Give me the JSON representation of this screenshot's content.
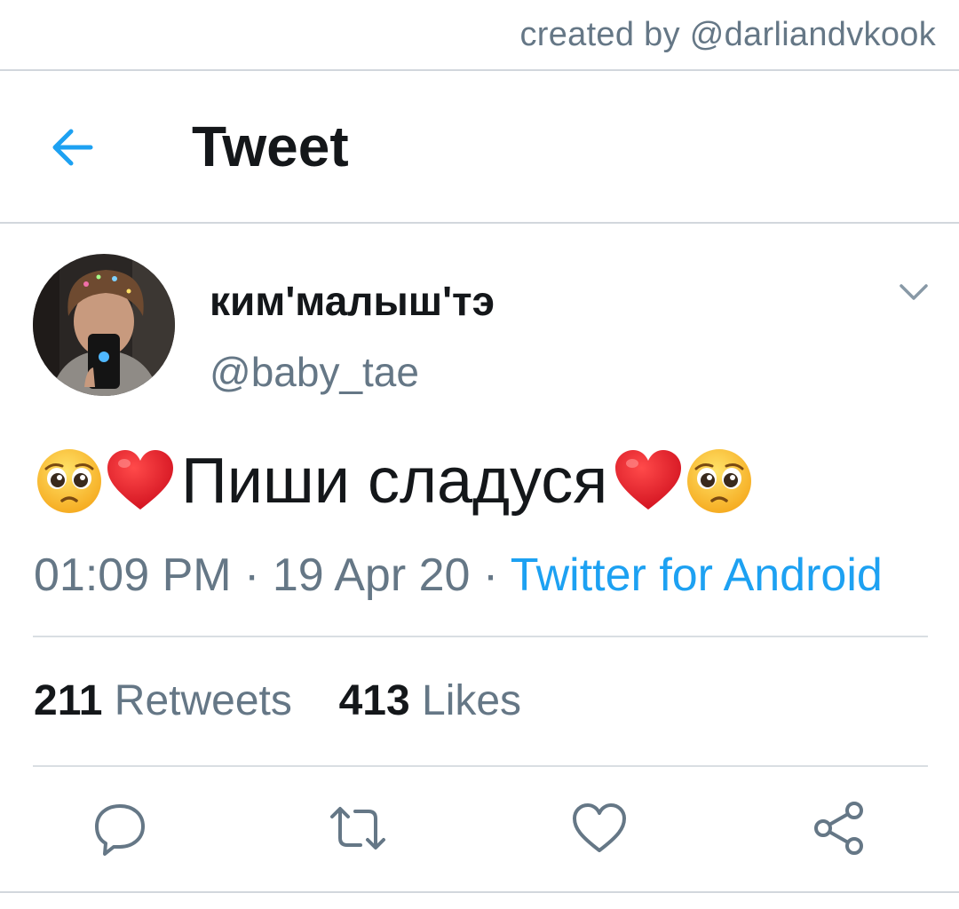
{
  "watermark": {
    "text": "created by @darliandvkook"
  },
  "header": {
    "title": "Tweet",
    "back_icon": "arrow-left-icon"
  },
  "author": {
    "display_name": "ким'малыш'тэ",
    "handle": "@baby_tae",
    "menu_icon": "chevron-down-icon"
  },
  "tweet": {
    "text": "Пиши сладуся",
    "leading_emojis": [
      "pleading-face-emoji",
      "red-heart-emoji"
    ],
    "trailing_emojis": [
      "red-heart-emoji",
      "pleading-face-emoji"
    ],
    "time": "01:09 PM",
    "separator": "·",
    "date": "19 Apr 20",
    "source": "Twitter for Android"
  },
  "stats": {
    "retweets_count": "211",
    "retweets_label": "Retweets",
    "likes_count": "413",
    "likes_label": "Likes"
  },
  "actions": [
    "reply-icon",
    "retweet-icon",
    "like-icon",
    "share-icon"
  ],
  "colors": {
    "accent": "#1da1f2",
    "text_primary": "#14171a",
    "text_secondary": "#657786",
    "divider": "#d9dee3",
    "heart": "#e0192b",
    "emoji_face": "#fbc02d"
  }
}
